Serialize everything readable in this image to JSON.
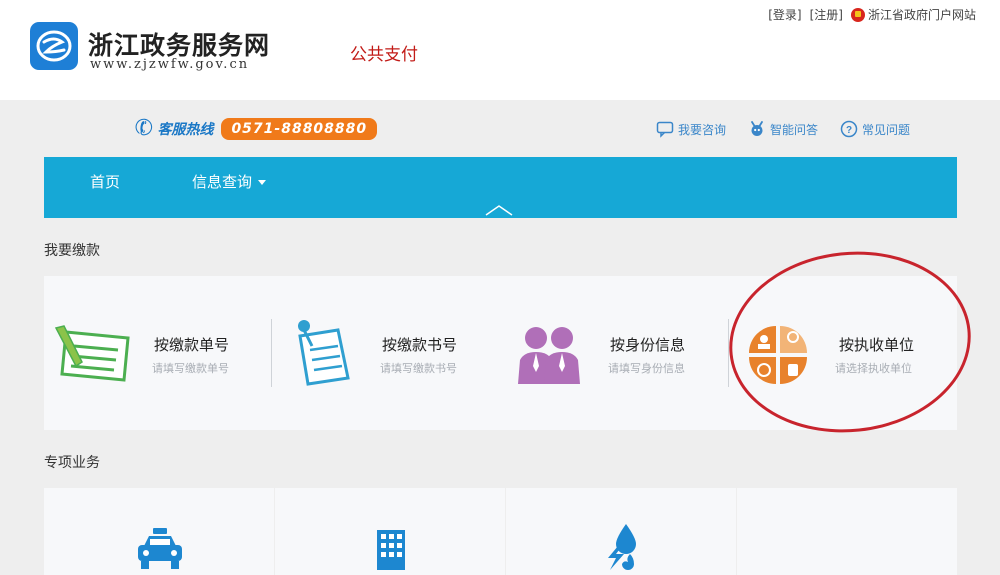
{
  "header": {
    "site_title": "浙江政务服务网",
    "site_url": "www.zjzwfw.gov.cn",
    "service_name": "公共支付",
    "links": {
      "login": "[登录]",
      "register": "[注册]",
      "portal": "浙江省政府门户网站"
    }
  },
  "hotline": {
    "label": "客服热线",
    "number": "0571-88808880"
  },
  "help_links": [
    {
      "label": "我要咨询",
      "icon": "chat-bubble-icon"
    },
    {
      "label": "智能问答",
      "icon": "robot-icon"
    },
    {
      "label": "常见问题",
      "icon": "question-circle-icon"
    }
  ],
  "nav": {
    "home": "首页",
    "info_query": "信息查询"
  },
  "payment_section": {
    "title": "我要缴款",
    "items": [
      {
        "name": "按缴款单号",
        "hint": "请填写缴款单号",
        "icon": "form-pen-icon"
      },
      {
        "name": "按缴款书号",
        "hint": "请填写缴款书号",
        "icon": "document-pin-icon"
      },
      {
        "name": "按身份信息",
        "hint": "请填写身份信息",
        "icon": "people-icon"
      },
      {
        "name": "按执收单位",
        "hint": "请选择执收单位",
        "icon": "agency-quad-icon"
      }
    ]
  },
  "special_section": {
    "title": "专项业务",
    "items": [
      {
        "icon": "taxi-icon"
      },
      {
        "icon": "building-icon"
      },
      {
        "icon": "utilities-icon"
      },
      {
        "icon": ""
      }
    ]
  },
  "colors": {
    "nav": "#16a8d6",
    "accent": "#f07a1a",
    "highlight": "#c8242d",
    "brand_blue": "#1e7fd6"
  }
}
